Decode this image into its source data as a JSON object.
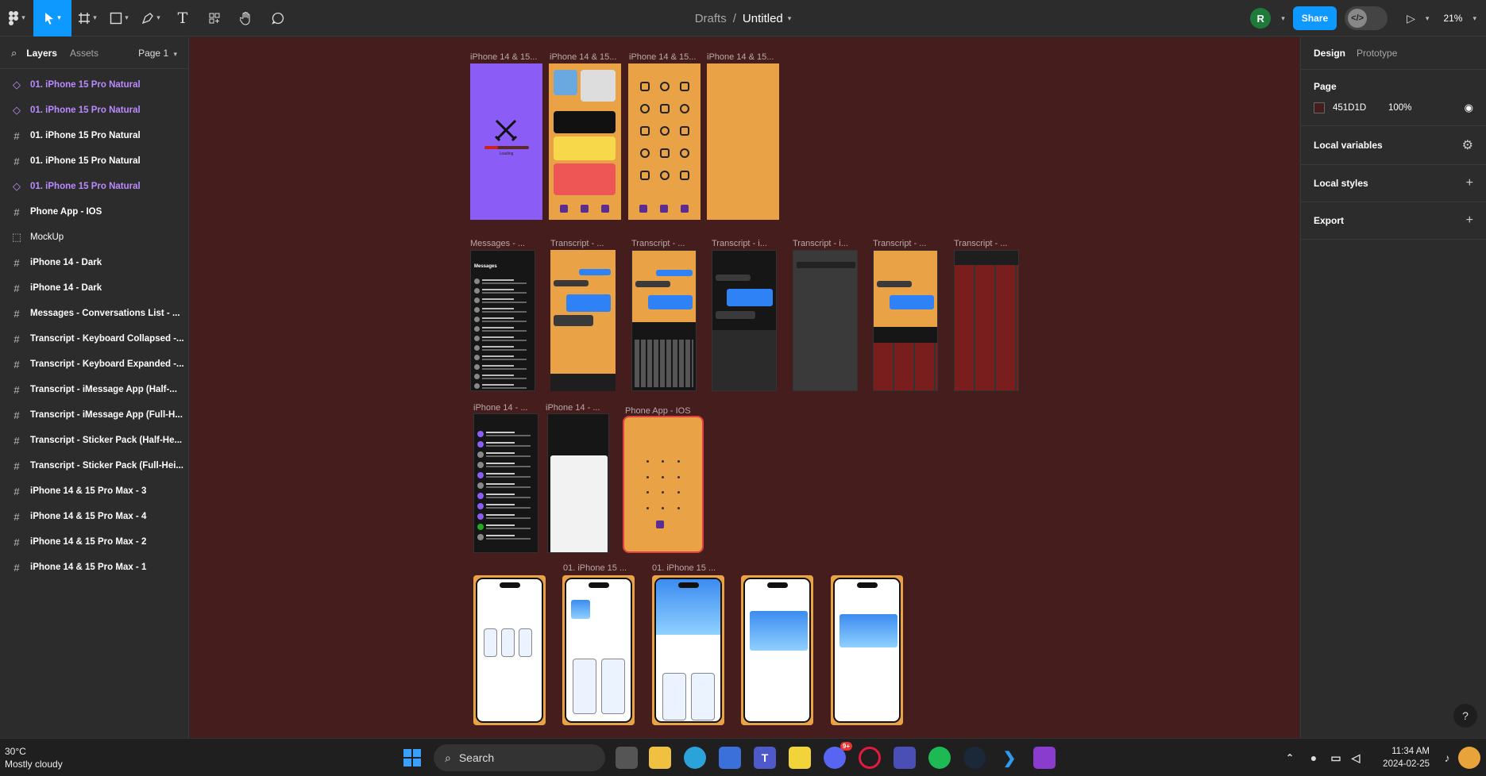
{
  "toolbar": {
    "breadcrumb_root": "Drafts",
    "separator": "/",
    "file_name": "Untitled",
    "share_label": "Share",
    "avatar_initial": "R",
    "zoom": "21%",
    "icons": [
      "figma-menu-icon",
      "move-tool-icon",
      "frame-tool-icon",
      "shape-tool-icon",
      "pen-tool-icon",
      "text-tool-icon",
      "components-icon",
      "hand-tool-icon",
      "comment-icon",
      "dev-mode-icon",
      "play-icon"
    ]
  },
  "left_panel": {
    "tabs": [
      "Layers",
      "Assets"
    ],
    "page_selector": "Page 1",
    "layers": [
      {
        "name": "01. iPhone 15 Pro Natural",
        "kind": "component"
      },
      {
        "name": "01. iPhone 15 Pro Natural",
        "kind": "component"
      },
      {
        "name": "01. iPhone 15 Pro Natural",
        "kind": "frame"
      },
      {
        "name": "01. iPhone 15 Pro Natural",
        "kind": "frame"
      },
      {
        "name": "01. iPhone 15 Pro Natural",
        "kind": "component"
      },
      {
        "name": "Phone App - IOS",
        "kind": "frame"
      },
      {
        "name": "MockUp",
        "kind": "section"
      },
      {
        "name": "iPhone 14 - Dark",
        "kind": "frame"
      },
      {
        "name": "iPhone 14 - Dark",
        "kind": "frame"
      },
      {
        "name": "Messages - Conversations List - ...",
        "kind": "frame"
      },
      {
        "name": "Transcript - Keyboard Collapsed -...",
        "kind": "frame"
      },
      {
        "name": "Transcript - Keyboard Expanded -...",
        "kind": "frame"
      },
      {
        "name": "Transcript - iMessage App (Half-...",
        "kind": "frame"
      },
      {
        "name": "Transcript - iMessage App (Full-H...",
        "kind": "frame"
      },
      {
        "name": "Transcript - Sticker Pack (Half-He...",
        "kind": "frame"
      },
      {
        "name": "Transcript - Sticker Pack (Full-Hei...",
        "kind": "frame"
      },
      {
        "name": "iPhone 14 & 15 Pro Max - 3",
        "kind": "frame"
      },
      {
        "name": "iPhone 14 & 15 Pro Max - 4",
        "kind": "frame"
      },
      {
        "name": "iPhone 14 & 15 Pro Max - 2",
        "kind": "frame"
      },
      {
        "name": "iPhone 14 & 15 Pro Max - 1",
        "kind": "frame"
      }
    ]
  },
  "canvas": {
    "background": "#451d1d",
    "row1_labels": [
      "iPhone 14 & 15...",
      "iPhone 14 & 15...",
      "iPhone 14 & 15...",
      "iPhone 14 & 15..."
    ],
    "row2_labels": [
      "Messages - ...",
      "Transcript - ...",
      "Transcript - ...",
      "Transcript - i...",
      "Transcript - i...",
      "Transcript - ...",
      "Transcript - ..."
    ],
    "row3_labels": [
      "iPhone 14 - ...",
      "iPhone 14 - ...",
      "Phone App - IOS"
    ],
    "row4_labels": [
      "01. iPhone 15 ...",
      "01. iPhone 15 ..."
    ],
    "loading_text": "Loading",
    "messages_title": "Messages"
  },
  "right_panel": {
    "tabs": [
      "Design",
      "Prototype"
    ],
    "page_heading": "Page",
    "page_color": "451D1D",
    "page_opacity": "100%",
    "sections": [
      "Local variables",
      "Local styles",
      "Export"
    ]
  },
  "taskbar": {
    "temperature": "30°C",
    "weather": "Mostly cloudy",
    "search_label": "Search",
    "time": "11:34 AM",
    "date": "2024-02-25",
    "discord_badge": "9+"
  },
  "help_label": "?"
}
